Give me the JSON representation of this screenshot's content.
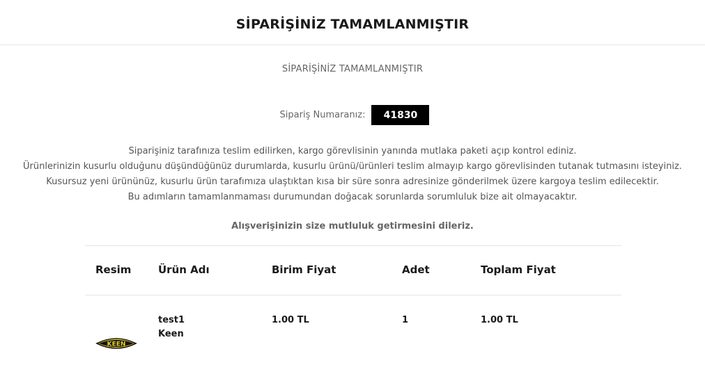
{
  "header": {
    "title": "SİPARİŞİNİZ TAMAMLANMIŞTIR"
  },
  "page": {
    "subtitle": "SİPARİŞİNİZ TAMAMLANMIŞTIR",
    "order_label": "Sipariş Numaranız:",
    "order_number": "41830",
    "info_lines": [
      "Siparişiniz tarafınıza teslim edilirken, kargo görevlisinin yanında mutlaka paketi açıp kontrol ediniz.",
      "Ürünlerinizin kusurlu olduğunu düşündüğünüz durumlarda, kusurlu ürünü/ürünleri teslim almayıp kargo görevlisinden tutanak tutmasını isteyiniz.",
      "Kusursuz yeni ürününüz, kusurlu ürün tarafımıza ulaştıktan kısa bir süre sonra adresinize gönderilmek üzere kargoya teslim edilecektir.",
      "Bu adımların tamamlanmaması durumundan doğacak sorunlarda sorumluluk bize ait olmayacaktır."
    ],
    "wish": "Alışverişinizin size mutluluk getirmesini dileriz."
  },
  "table": {
    "headers": [
      "Resim",
      "Ürün Adı",
      "Birim Fiyat",
      "Adet",
      "Toplam Fiyat"
    ],
    "rows": [
      {
        "image_icon": "keen-logo",
        "image_text": "KEEN",
        "product_name": "test1",
        "brand": "Keen",
        "unit_price": "1.00 TL",
        "quantity": "1",
        "total_price": "1.00 TL"
      }
    ]
  }
}
